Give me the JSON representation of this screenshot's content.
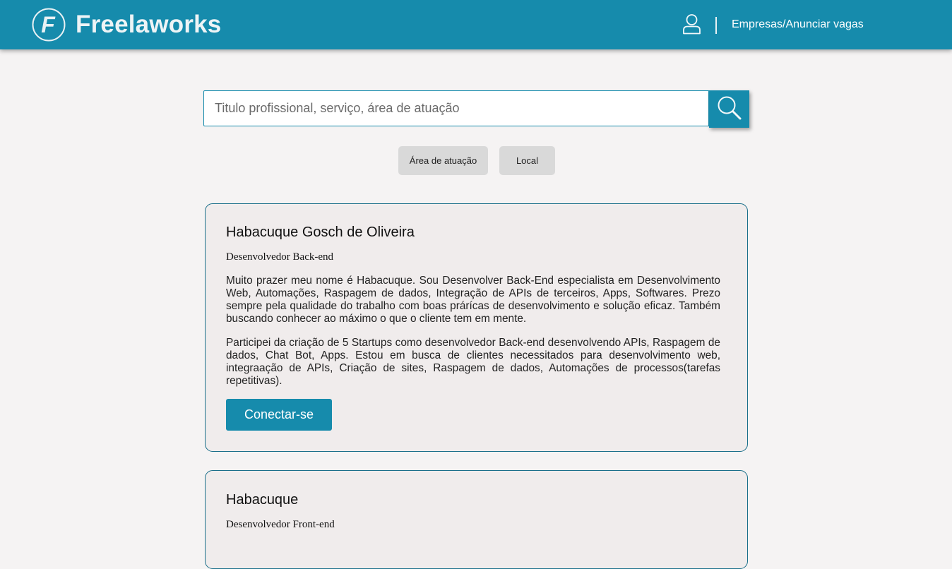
{
  "header": {
    "brand": "Freelaworks",
    "logo_letter": "F",
    "company_link": "Empresas/Anunciar vagas",
    "icons": {
      "logo": "logo-circle-f-icon",
      "user": "user-icon"
    }
  },
  "search": {
    "placeholder": "Titulo profissional, serviço, área de atuação",
    "button_icon": "search-icon"
  },
  "filters": {
    "area": "Área de atuação",
    "local": "Local"
  },
  "profiles": [
    {
      "name": "Habacuque Gosch de Oliveira",
      "role": "Desenvolvedor Back-end",
      "paragraphs": [
        "Muito prazer meu nome é Habacuque. Sou Desenvolver Back-End especialista em Desenvolvimento Web, Automações, Raspagem de dados, Integração de APIs de terceiros, Apps, Softwares. Prezo sempre pela qualidade do trabalho com boas prárícas de desenvolvimento e solução eficaz. Também buscando conhecer ao máximo o que o cliente tem em mente.",
        "Participei da criação de 5 Startups como desenvolvedor Back-end desenvolvendo APIs, Raspagem de dados, Chat Bot, Apps. Estou em busca de clientes necessitados para desenvolvimento web, integraação de APIs, Criação de sites, Raspagem de dados, Automações de processos(tarefas repetitivas)."
      ],
      "button": "Conectar-se"
    },
    {
      "name": "Habacuque",
      "role": "Desenvolvedor Front-end"
    }
  ],
  "colors": {
    "primary": "#168bac",
    "background": "#f5f3f3",
    "card": "#f0ecec",
    "filter_chip": "#d9d9d9",
    "card_border": "#1a6f8a"
  }
}
